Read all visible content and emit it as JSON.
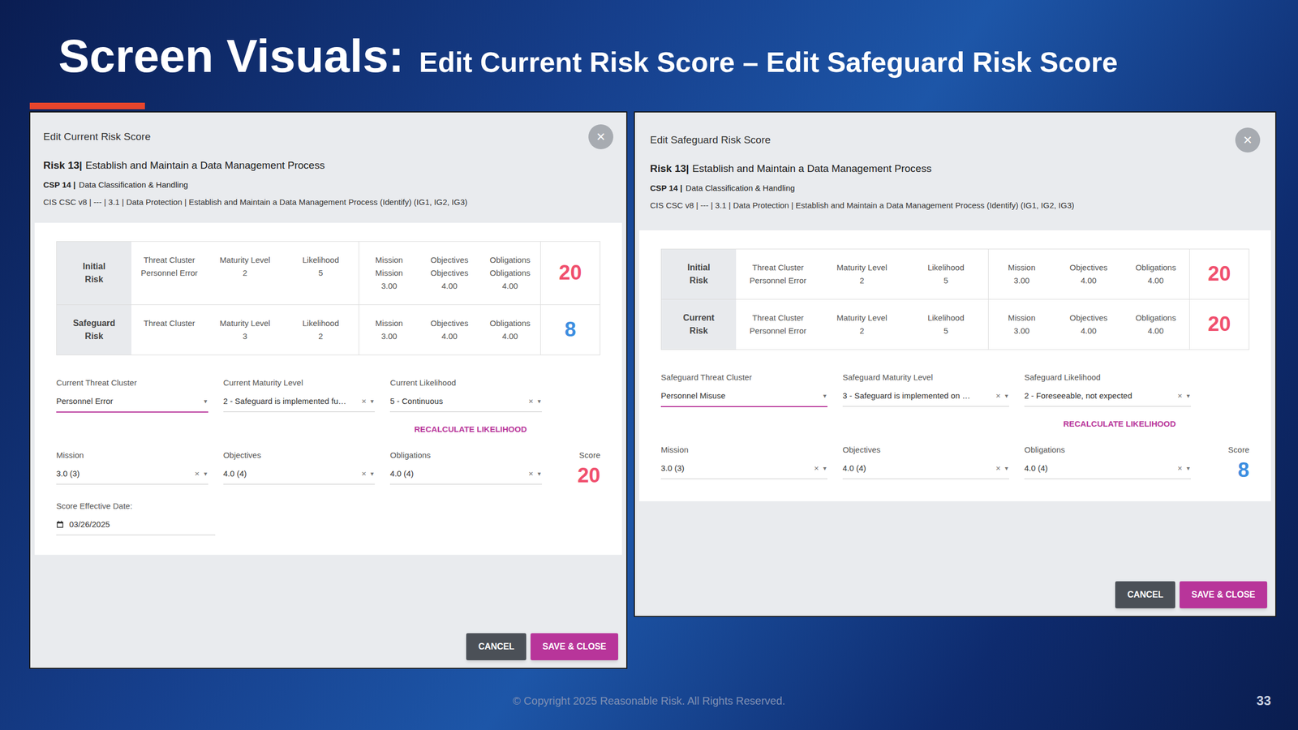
{
  "slide": {
    "title": "Screen Visuals:",
    "subtitle": "Edit Current Risk Score – Edit Safeguard Risk Score",
    "footer": "© Copyright 2025 Reasonable Risk. All Rights Reserved.",
    "page": "33"
  },
  "dialogs": [
    {
      "title": "Edit Current Risk Score",
      "close": "×",
      "risk_id": "Risk 13|",
      "risk_name": "Establish and Maintain a Data Management Process",
      "csp_id": "CSP 14 |",
      "csp_name": "Data Classification & Handling",
      "framework": "CIS CSC v8 | --- | 3.1 | Data Protection | Establish and Maintain a Data Management Process (Identify) (IG1, IG2, IG3)",
      "table": [
        {
          "label": [
            "Initial",
            "Risk"
          ],
          "cells": [
            [
              "Threat Cluster",
              "Personnel Error"
            ],
            [
              "Maturity Level",
              "2"
            ],
            [
              "Likelihood",
              "5"
            ],
            [
              "Mission",
              "Mission",
              "3.00"
            ],
            [
              "Objectives",
              "Objectives",
              "4.00"
            ],
            [
              "Obligations",
              "Obligations",
              "4.00"
            ]
          ],
          "score": "20",
          "color": "#f0506e"
        },
        {
          "label": [
            "Safeguard",
            "Risk"
          ],
          "cells": [
            [
              "Threat Cluster"
            ],
            [
              "Maturity Level",
              "3"
            ],
            [
              "Likelihood",
              "2"
            ],
            [
              "Mission",
              "3.00"
            ],
            [
              "Objectives",
              "4.00"
            ],
            [
              "Obligations",
              "4.00"
            ]
          ],
          "score": "8",
          "color": "#3d8ee0"
        }
      ],
      "fields": [
        {
          "label": "Current Threat Cluster",
          "value": "Personnel Error",
          "caret": "▾",
          "focused": true
        },
        {
          "label": "Current Maturity Level",
          "value": "2 - Safeguard is implemented fu…",
          "clear": "×",
          "caret": "▾",
          "focused": false
        },
        {
          "label": "Current Likelihood",
          "value": "5 - Continuous",
          "clear": "×",
          "caret": "▾",
          "focused": false
        }
      ],
      "recalc": "RECALCULATE LIKELIHOOD",
      "impact": [
        {
          "label": "Mission",
          "value": "3.0 (3)",
          "clear": "×",
          "caret": "▾",
          "focused": false
        },
        {
          "label": "Objectives",
          "value": "4.0 (4)",
          "clear": "×",
          "caret": "▾",
          "focused": false
        },
        {
          "label": "Obligations",
          "value": "4.0 (4)",
          "clear": "×",
          "caret": "▾",
          "focused": false
        }
      ],
      "score_label": "Score",
      "score": "20",
      "score_color": "#f0506e",
      "date": {
        "label": "Score Effective Date:",
        "value": "03/26/2025"
      },
      "buttons": [
        "CANCEL",
        "SAVE & CLOSE"
      ]
    },
    {
      "title": "Edit Safeguard Risk Score",
      "close": "×",
      "risk_id": "Risk 13|",
      "risk_name": "Establish and Maintain a Data Management Process",
      "csp_id": "CSP 14 |",
      "csp_name": "Data Classification & Handling",
      "framework": "CIS CSC v8 | --- | 3.1 | Data Protection | Establish and Maintain a Data Management Process (Identify) (IG1, IG2, IG3)",
      "table": [
        {
          "label": [
            "Initial",
            "Risk"
          ],
          "cells": [
            [
              "Threat Cluster",
              "Personnel Error"
            ],
            [
              "Maturity Level",
              "2"
            ],
            [
              "Likelihood",
              "5"
            ],
            [
              "Mission",
              "3.00"
            ],
            [
              "Objectives",
              "4.00"
            ],
            [
              "Obligations",
              "4.00"
            ]
          ],
          "score": "20",
          "color": "#f0506e"
        },
        {
          "label": [
            "Current",
            "Risk"
          ],
          "cells": [
            [
              "Threat Cluster",
              "Personnel Error"
            ],
            [
              "Maturity Level",
              "2"
            ],
            [
              "Likelihood",
              "5"
            ],
            [
              "Mission",
              "3.00"
            ],
            [
              "Objectives",
              "4.00"
            ],
            [
              "Obligations",
              "4.00"
            ]
          ],
          "score": "20",
          "color": "#f0506e"
        }
      ],
      "fields": [
        {
          "label": "Safeguard Threat Cluster",
          "value": "Personnel Misuse",
          "caret": "▾",
          "focused": true
        },
        {
          "label": "Safeguard Maturity Level",
          "value": "3 - Safeguard is implemented on …",
          "clear": "×",
          "caret": "▾",
          "focused": false
        },
        {
          "label": "Safeguard Likelihood",
          "value": "2 - Foreseeable, not expected",
          "clear": "×",
          "caret": "▾",
          "focused": false
        }
      ],
      "recalc": "RECALCULATE LIKELIHOOD",
      "impact": [
        {
          "label": "Mission",
          "value": "3.0 (3)",
          "clear": "×",
          "caret": "▾",
          "focused": false
        },
        {
          "label": "Objectives",
          "value": "4.0 (4)",
          "clear": "×",
          "caret": "▾",
          "focused": false
        },
        {
          "label": "Obligations",
          "value": "4.0 (4)",
          "clear": "×",
          "caret": "▾",
          "focused": false
        }
      ],
      "score_label": "Score",
      "score": "8",
      "score_color": "#3d8ee0",
      "buttons": [
        "CANCEL",
        "SAVE & CLOSE"
      ]
    }
  ]
}
